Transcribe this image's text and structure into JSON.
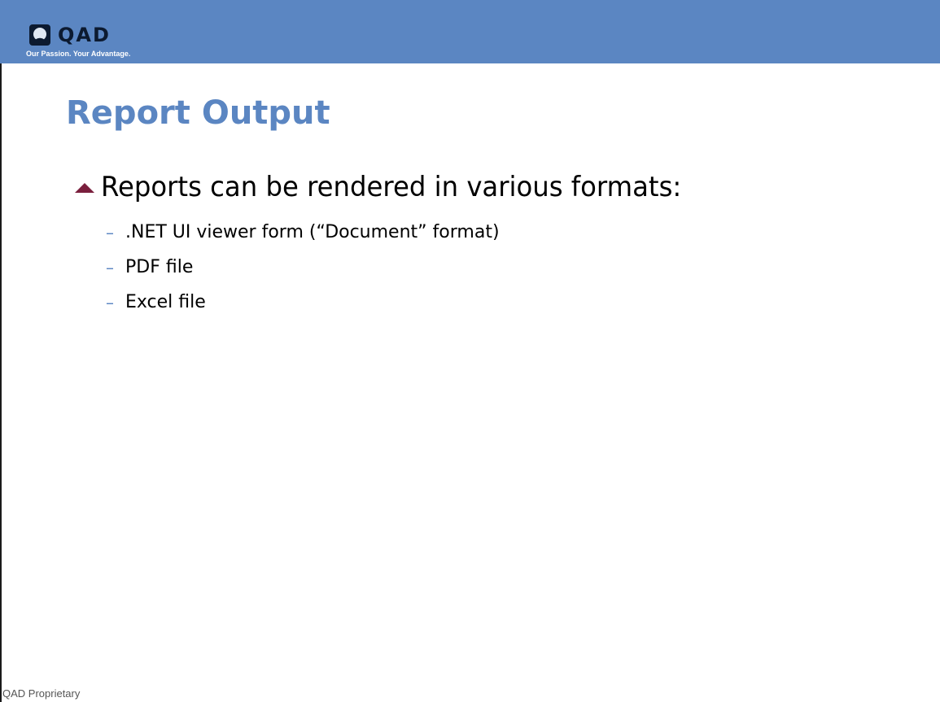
{
  "header": {
    "logo": {
      "wordmark": "QAD",
      "tagline": "Our Passion. Your Advantage.",
      "icon": "qad-logo-icon"
    },
    "background_color": "#5b86c2"
  },
  "slide": {
    "title": "Report Output",
    "title_color": "#5b86c2",
    "bullets": [
      {
        "text": "Reports can be rendered in various formats:",
        "icon": "triangle-bullet-icon",
        "icon_color": "#7a1f3d",
        "sub_items": [
          {
            "text": ".NET UI viewer form (“Document” format)"
          },
          {
            "text": "PDF file"
          },
          {
            "text": "Excel file"
          }
        ]
      }
    ]
  },
  "footer": {
    "text": "QAD Proprietary"
  }
}
